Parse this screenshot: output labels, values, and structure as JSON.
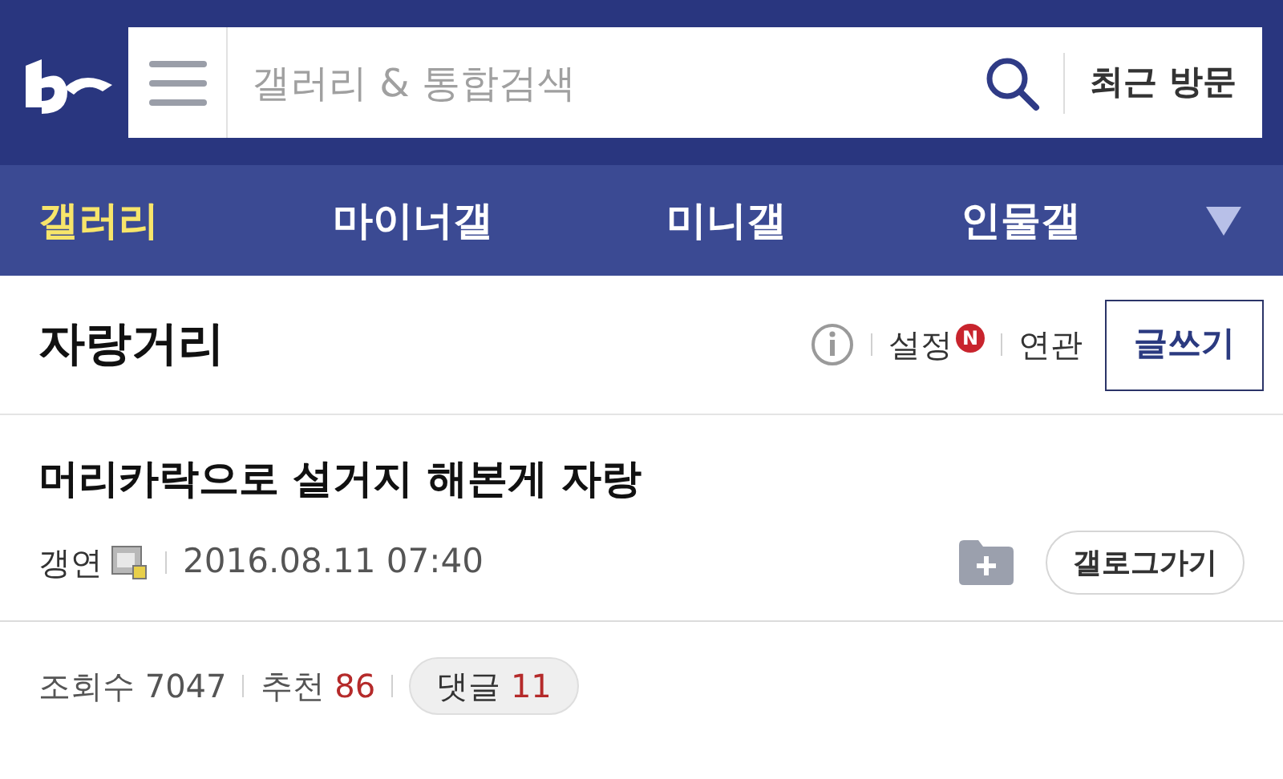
{
  "header": {
    "search": {
      "placeholder": "갤러리 & 통합검색"
    },
    "recent_button": "최근 방문"
  },
  "nav": {
    "tabs": [
      {
        "label": "갤러리",
        "selected": true
      },
      {
        "label": "마이너갤",
        "selected": false
      },
      {
        "label": "미니갤",
        "selected": false
      },
      {
        "label": "인물갤",
        "selected": false
      }
    ]
  },
  "board": {
    "title": "자랑거리",
    "settings": "설정",
    "settings_badge": "N",
    "related": "연관",
    "write_button": "글쓰기"
  },
  "post": {
    "title": "머리카락으로 설거지 해본게 자랑",
    "author": "갱연",
    "date": "2016.08.11 07:40",
    "gallog_button": "갤로그가기",
    "stats": [
      {
        "label": "조회수",
        "value": "7047",
        "highlight": false
      },
      {
        "label": "추천",
        "value": "86",
        "highlight": true
      },
      {
        "label": "댓글",
        "value": "11",
        "highlight": true,
        "kind": "pill"
      }
    ]
  }
}
